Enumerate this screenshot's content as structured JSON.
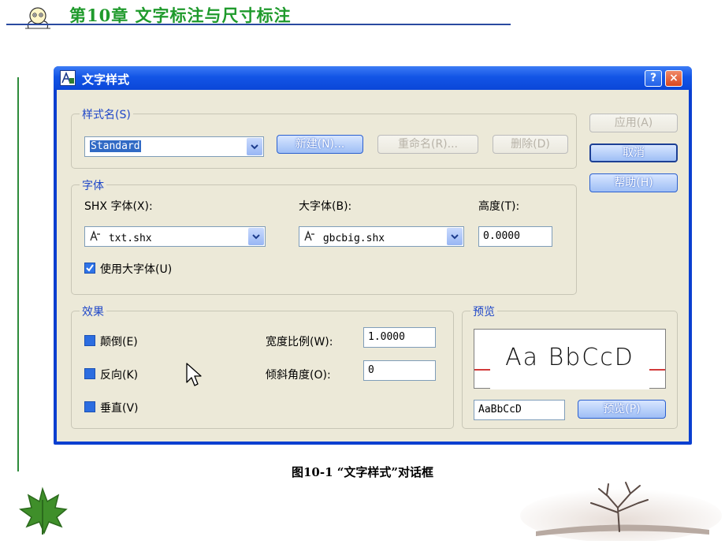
{
  "page": {
    "chapter_title": "第10章  文字标注与尺寸标注",
    "figure_caption": "图10-1  “文字样式”对话框"
  },
  "dialog": {
    "title": "文字样式",
    "help_glyph": "?",
    "close_glyph": "×",
    "style_group": {
      "legend": "样式名(S)",
      "selected_style": "Standard",
      "new_button": "新建(N)...",
      "rename_button": "重命名(R)...",
      "delete_button": "删除(D)"
    },
    "font_group": {
      "legend": "字体",
      "shx_font_label": "SHX 字体(X):",
      "shx_font_value": "txt.shx",
      "big_font_label": "大字体(B):",
      "big_font_value": "gbcbig.shx",
      "height_label": "高度(T):",
      "height_value": "0.0000",
      "use_big_font_label": "使用大字体(U)",
      "use_big_font_checked": true
    },
    "effects_group": {
      "legend": "效果",
      "upside_down_label": "颠倒(E)",
      "backwards_label": "反向(K)",
      "vertical_label": "垂直(V)",
      "width_factor_label": "宽度比例(W):",
      "width_factor_value": "1.0000",
      "oblique_angle_label": "倾斜角度(O):",
      "oblique_angle_value": "0"
    },
    "preview_group": {
      "legend": "预览",
      "sample_text": "Aa BbCcD",
      "preview_input_value": "AaBbCcD",
      "preview_button": "预览(P)"
    },
    "buttons": {
      "apply": "应用(A)",
      "cancel": "取消",
      "help": "帮助(H)"
    }
  },
  "colors": {
    "chapter_title": "#1f9a2c",
    "title_bar": "#0a46d8",
    "dialog_face": "#ece9d8",
    "group_legend": "#1e46c8"
  }
}
